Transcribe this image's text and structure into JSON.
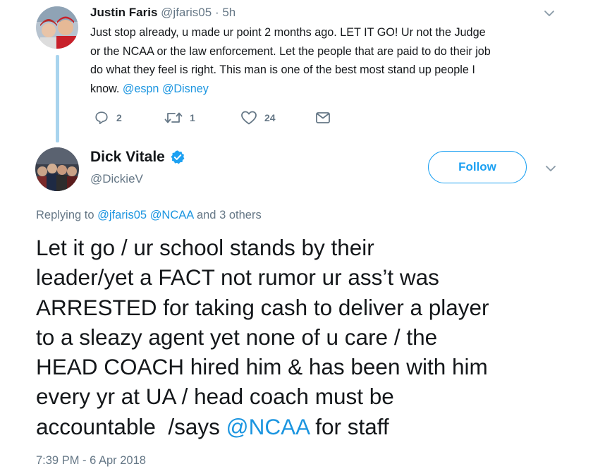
{
  "reply_tweet": {
    "author_name": "Justin Faris",
    "author_handle": "@jfaris05",
    "time": "· 5h",
    "text_lines": [
      "Just stop already, u made ur point 2 months ago.  LET IT GO!  Ur not the Judge",
      "or the NCAA or the law enforcement.  Let the people that are paid to do their job",
      "do what they feel is right.  This man is one of the best most stand up people I",
      "know. "
    ],
    "mentions": [
      "@espn",
      "@Disney"
    ],
    "reply_count": "2",
    "retweet_count": "1",
    "like_count": "24",
    "icons": {
      "menu": "chevron-down-icon",
      "reply": "reply-icon",
      "retweet": "retweet-icon",
      "like": "heart-icon",
      "message": "envelope-icon",
      "avatar": "avatar"
    }
  },
  "main_tweet": {
    "author_name": "Dick Vitale",
    "author_handle": "@DickieV",
    "follow_label": "Follow",
    "replying_prefix": "Replying to ",
    "replying_mentions": [
      "@jfaris05",
      "@NCAA"
    ],
    "replying_suffix": " and 3 others",
    "text_lines": [
      "Let it go / ur school stands by their",
      "leader/yet a FACT not rumor ur ass’t was",
      "ARRESTED for taking cash to deliver a player",
      "to a sleazy agent yet none of u care / the",
      "HEAD COACH hired him & has been with him",
      "every yr at UA / head coach must be",
      "accountable  /says "
    ],
    "text_mention": "@NCAA",
    "text_tail": " for staff",
    "timestamp": "7:39 PM - 6 Apr 2018",
    "icons": {
      "verified": "verified-badge-icon",
      "menu": "chevron-down-icon"
    }
  },
  "colors": {
    "link": "#1b95e0",
    "follow_blue": "#1da1f2",
    "secondary_text": "#657786",
    "thread_line": "#a8d4ee"
  }
}
